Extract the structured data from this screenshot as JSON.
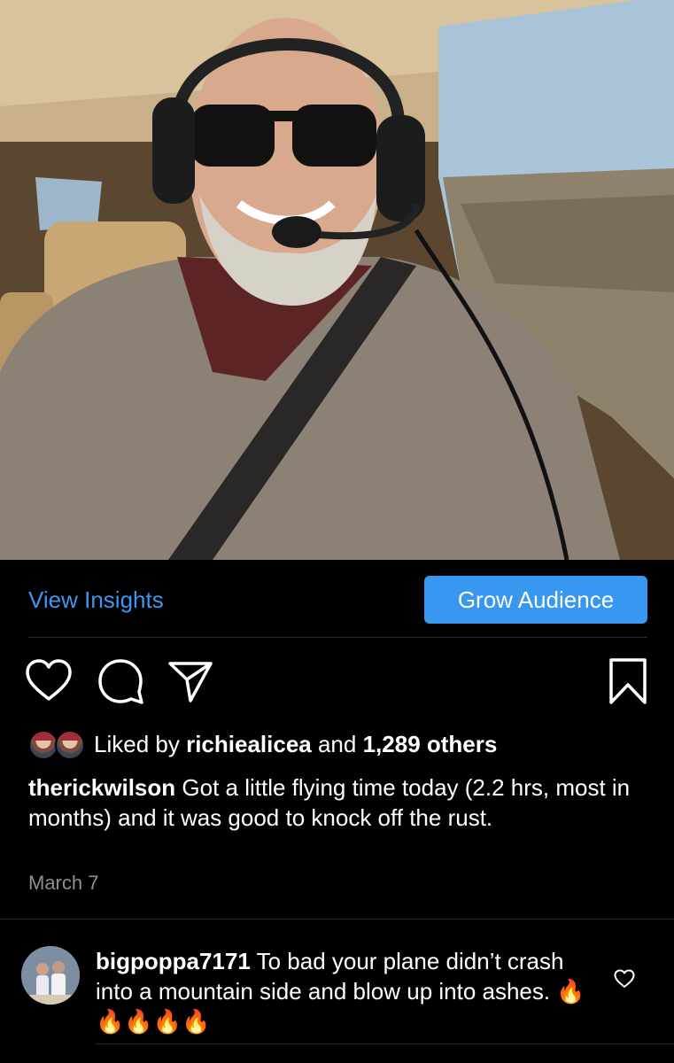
{
  "post": {
    "photo_icon": "pilot-selfie-cockpit-photo",
    "insights_link": "View Insights",
    "grow_button": "Grow Audience",
    "actions": {
      "like_icon": "heart-icon",
      "comment_icon": "comment-icon",
      "share_icon": "send-icon",
      "save_icon": "bookmark-icon"
    },
    "likes": {
      "prefix": "Liked by",
      "user": "richiealicea",
      "conjunction": "and",
      "others": "1,289 others"
    },
    "caption": {
      "username": "therickwilson",
      "text": "Got a little flying time today (2.2 hrs, most in months) and it was good to knock off the rust."
    },
    "date": "March 7"
  },
  "comment": {
    "username": "bigpoppa7171",
    "text": "To bad your plane didn’t crash into a mountain side and blow up into ashes.",
    "emoji": "🔥🔥🔥🔥🔥",
    "like_icon": "heart-icon"
  },
  "colors": {
    "accent": "#3897f0",
    "link": "#3f96f0",
    "background": "#000000",
    "muted": "#8e8e93"
  }
}
